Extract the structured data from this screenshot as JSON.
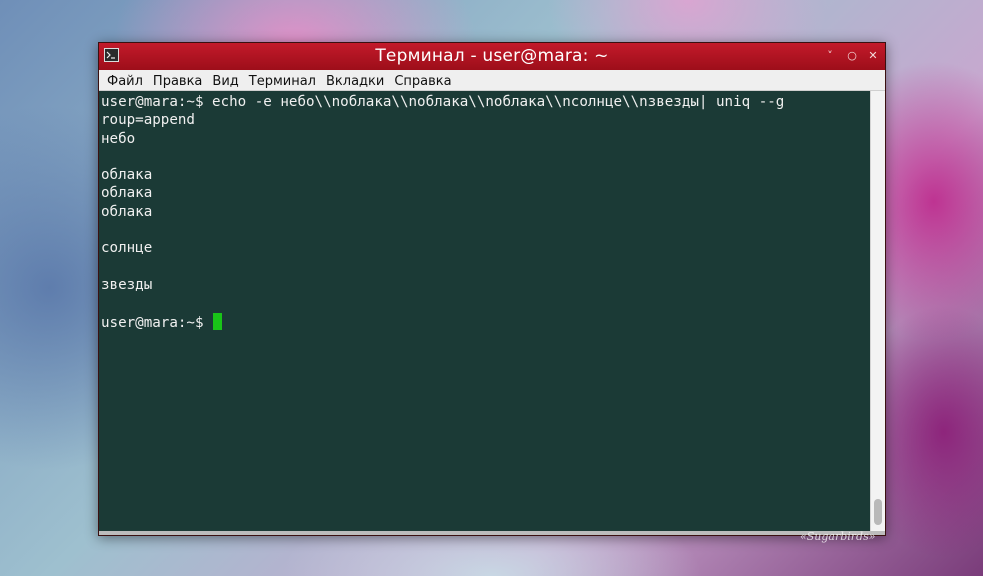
{
  "window": {
    "title": "Терминал - user@mara: ~",
    "controls": {
      "minimize": "˅",
      "maximize": "○",
      "close": "✕"
    },
    "colors": {
      "titlebar": "#b5121f",
      "terminal_bg": "#1b3a36",
      "cursor": "#19c418"
    }
  },
  "menubar": {
    "items": [
      "Файл",
      "Правка",
      "Вид",
      "Терминал",
      "Вкладки",
      "Справка"
    ]
  },
  "terminal": {
    "lines": [
      "user@mara:~$ echo -e небо\\\\nоблака\\\\nоблака\\\\nоблака\\\\nсолнце\\\\nзвезды| uniq --g",
      "roup=append",
      "небо",
      "",
      "облака",
      "облака",
      "облака",
      "",
      "солнце",
      "",
      "звезды",
      "",
      "user@mara:~$ "
    ]
  },
  "desktop": {
    "watermark": "«Sugarbirds»",
    "icons": {
      "window_icon": "terminal-icon"
    }
  }
}
